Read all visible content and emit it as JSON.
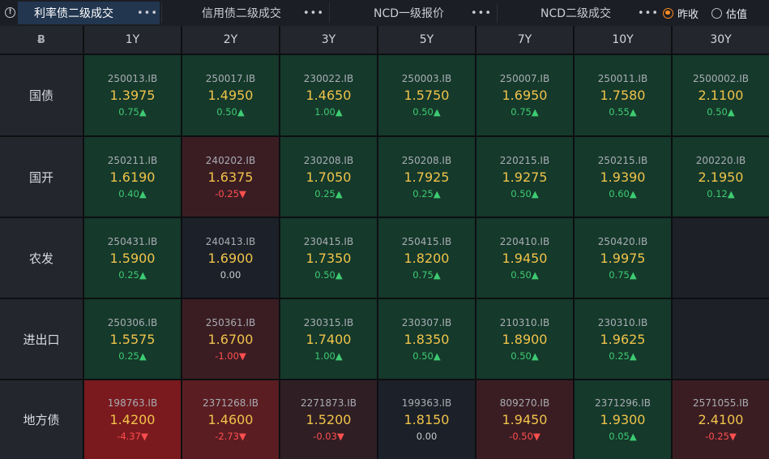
{
  "tabs": [
    {
      "label": "利率债二级成交",
      "active": true
    },
    {
      "label": "信用债二级成交",
      "active": false
    },
    {
      "label": "NCD一级报价",
      "active": false
    },
    {
      "label": "NCD二级成交",
      "active": false
    }
  ],
  "more_glyph": "•••",
  "quote_mode": {
    "options": [
      {
        "label": "昨收",
        "selected": true
      },
      {
        "label": "估值",
        "selected": false
      }
    ]
  },
  "grid": {
    "corner_icon": "Ƀ",
    "tenors": [
      "1Y",
      "2Y",
      "3Y",
      "5Y",
      "7Y",
      "10Y",
      "30Y"
    ],
    "rows": [
      {
        "name": "国债",
        "cells": [
          {
            "code": "250013.IB",
            "yield": "1.3975",
            "change": "0.75▲",
            "dir": "up",
            "tone": "g"
          },
          {
            "code": "250017.IB",
            "yield": "1.4950",
            "change": "0.50▲",
            "dir": "up",
            "tone": "g"
          },
          {
            "code": "230022.IB",
            "yield": "1.4650",
            "change": "1.00▲",
            "dir": "up",
            "tone": "g"
          },
          {
            "code": "250003.IB",
            "yield": "1.5750",
            "change": "0.50▲",
            "dir": "up",
            "tone": "g"
          },
          {
            "code": "250007.IB",
            "yield": "1.6950",
            "change": "0.75▲",
            "dir": "up",
            "tone": "g"
          },
          {
            "code": "250011.IB",
            "yield": "1.7580",
            "change": "0.55▲",
            "dir": "up",
            "tone": "g"
          },
          {
            "code": "2500002.IB",
            "yield": "2.1100",
            "change": "0.50▲",
            "dir": "up",
            "tone": "g"
          }
        ]
      },
      {
        "name": "国开",
        "cells": [
          {
            "code": "250211.IB",
            "yield": "1.6190",
            "change": "0.40▲",
            "dir": "up",
            "tone": "g"
          },
          {
            "code": "240202.IB",
            "yield": "1.6375",
            "change": "-0.25▼",
            "dir": "down",
            "tone": "r"
          },
          {
            "code": "230208.IB",
            "yield": "1.7050",
            "change": "0.25▲",
            "dir": "up",
            "tone": "g"
          },
          {
            "code": "250208.IB",
            "yield": "1.7925",
            "change": "0.25▲",
            "dir": "up",
            "tone": "g"
          },
          {
            "code": "220215.IB",
            "yield": "1.9275",
            "change": "0.50▲",
            "dir": "up",
            "tone": "g"
          },
          {
            "code": "250215.IB",
            "yield": "1.9390",
            "change": "0.60▲",
            "dir": "up",
            "tone": "g"
          },
          {
            "code": "200220.IB",
            "yield": "2.1950",
            "change": "0.12▲",
            "dir": "up",
            "tone": "g"
          }
        ]
      },
      {
        "name": "农发",
        "cells": [
          {
            "code": "250431.IB",
            "yield": "1.5900",
            "change": "0.25▲",
            "dir": "up",
            "tone": "g"
          },
          {
            "code": "240413.IB",
            "yield": "1.6900",
            "change": "0.00",
            "dir": "flat",
            "tone": "n"
          },
          {
            "code": "230415.IB",
            "yield": "1.7350",
            "change": "0.50▲",
            "dir": "up",
            "tone": "g"
          },
          {
            "code": "250415.IB",
            "yield": "1.8200",
            "change": "0.75▲",
            "dir": "up",
            "tone": "g"
          },
          {
            "code": "220410.IB",
            "yield": "1.9450",
            "change": "0.50▲",
            "dir": "up",
            "tone": "g"
          },
          {
            "code": "250420.IB",
            "yield": "1.9975",
            "change": "0.75▲",
            "dir": "up",
            "tone": "g"
          },
          null
        ]
      },
      {
        "name": "进出口",
        "cells": [
          {
            "code": "250306.IB",
            "yield": "1.5575",
            "change": "0.25▲",
            "dir": "up",
            "tone": "g"
          },
          {
            "code": "250361.IB",
            "yield": "1.6700",
            "change": "-1.00▼",
            "dir": "down",
            "tone": "r"
          },
          {
            "code": "230315.IB",
            "yield": "1.7400",
            "change": "1.00▲",
            "dir": "up",
            "tone": "g"
          },
          {
            "code": "230307.IB",
            "yield": "1.8350",
            "change": "0.50▲",
            "dir": "up",
            "tone": "g"
          },
          {
            "code": "210310.IB",
            "yield": "1.8900",
            "change": "0.50▲",
            "dir": "up",
            "tone": "g"
          },
          {
            "code": "230310.IB",
            "yield": "1.9625",
            "change": "0.25▲",
            "dir": "up",
            "tone": "g"
          },
          null
        ]
      },
      {
        "name": "地方债",
        "cells": [
          {
            "code": "198763.IB",
            "yield": "1.4200",
            "change": "-4.37▼",
            "dir": "down",
            "tone": "R"
          },
          {
            "code": "2371268.IB",
            "yield": "1.4600",
            "change": "-2.73▼",
            "dir": "down",
            "tone": "rm"
          },
          {
            "code": "2271873.IB",
            "yield": "1.5200",
            "change": "-0.03▼",
            "dir": "down",
            "tone": "rl"
          },
          {
            "code": "199363.IB",
            "yield": "1.8150",
            "change": "0.00",
            "dir": "flat",
            "tone": "n"
          },
          {
            "code": "809270.IB",
            "yield": "1.9450",
            "change": "-0.50▼",
            "dir": "down",
            "tone": "r"
          },
          {
            "code": "2371296.IB",
            "yield": "1.9300",
            "change": "0.05▲",
            "dir": "up",
            "tone": "g"
          },
          {
            "code": "2571055.IB",
            "yield": "2.4100",
            "change": "-0.25▼",
            "dir": "down",
            "tone": "r"
          }
        ]
      }
    ]
  },
  "colors": {
    "tab_active_bg": "#22364f",
    "radio_selected": "#ff8a1e",
    "yield_text": "#f0c34a",
    "change_up": "#3ecb72",
    "change_down": "#ff4f4f",
    "tile_green": "#15392b",
    "tile_red": "#3a1d23",
    "tile_red_strong": "#7a1a1e",
    "tile_red_medium": "#5a1d22",
    "tile_red_light": "#2f1e24",
    "tile_neutral": "#1c2028",
    "tile_empty": "#1d2027"
  }
}
